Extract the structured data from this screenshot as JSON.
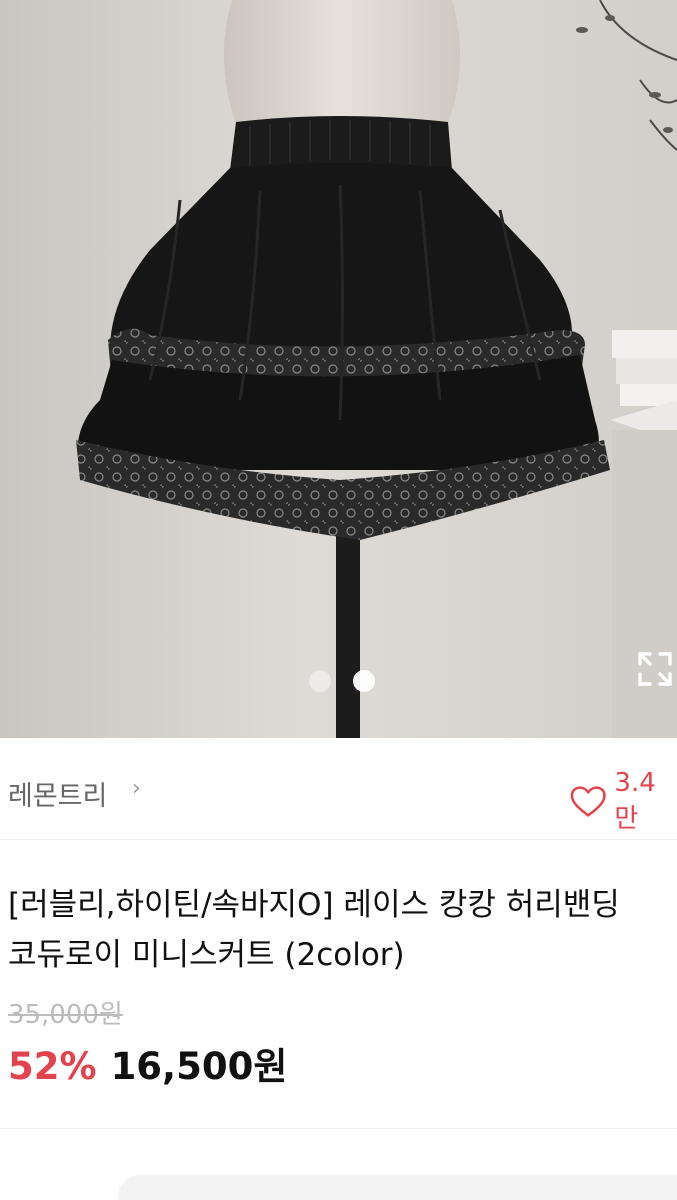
{
  "gallery": {
    "page_count": 2,
    "active_index": 1
  },
  "seller": {
    "name": "레몬트리",
    "chevron": "›"
  },
  "likes": {
    "count": "3.4만",
    "icon": "heart-outline-icon",
    "color": "#e2444f"
  },
  "product": {
    "title": "[러블리,하이틴/속바지O] 레이스 캉캉 허리밴딩\n코듀로이 미니스커트 (2color)",
    "original_price": "35,000원",
    "discount": "52%",
    "price": "16,500원"
  },
  "colors": {
    "accent": "#e2444f",
    "strike": "#bcbcbc"
  }
}
